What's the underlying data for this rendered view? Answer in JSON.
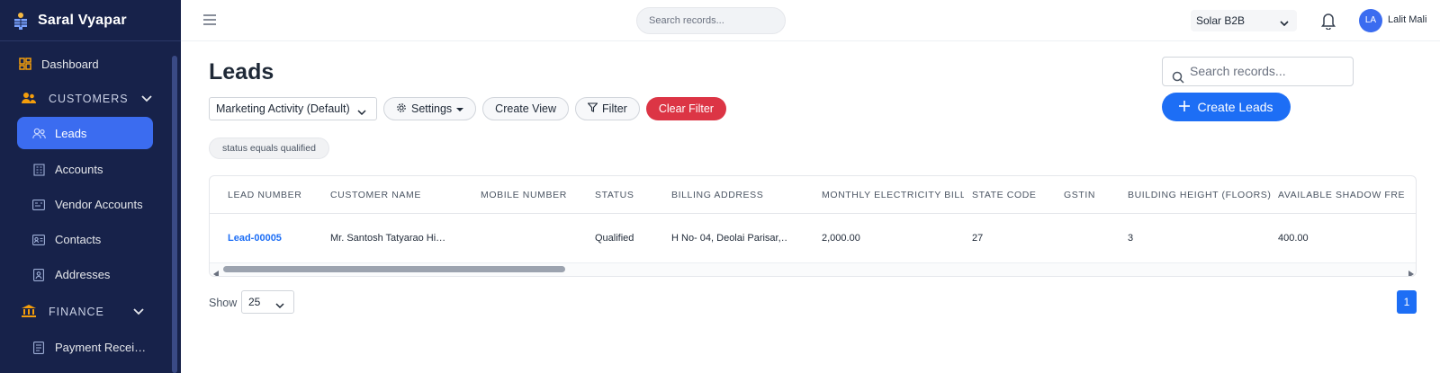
{
  "app": {
    "name": "Saral Vyapar"
  },
  "sidebar": {
    "dashboard": "Dashboard",
    "customers_section": "CUSTOMERS",
    "customers_items": [
      {
        "label": "Leads",
        "icon": "users-icon",
        "active": true
      },
      {
        "label": "Accounts",
        "icon": "building-icon"
      },
      {
        "label": "Vendor Accounts",
        "icon": "vendor-card-icon"
      },
      {
        "label": "Contacts",
        "icon": "contact-card-icon"
      },
      {
        "label": "Addresses",
        "icon": "address-book-icon"
      }
    ],
    "finance_section": "FINANCE",
    "finance_items": [
      {
        "label": "Payment Recei…",
        "icon": "receipt-icon"
      }
    ]
  },
  "topbar": {
    "search_placeholder": "Search records...",
    "org": "Solar B2B",
    "avatar_initials": "LA",
    "user_name": "Lalit Mali"
  },
  "page": {
    "title": "Leads",
    "search_placeholder": "Search records...",
    "create_label": "Create Leads",
    "view": "Marketing Activity (Default)",
    "settings_label": "Settings",
    "create_view_label": "Create View",
    "filter_label": "Filter",
    "clear_filter_label": "Clear Filter",
    "filter_chip": "status equals qualified"
  },
  "table": {
    "columns": [
      "LEAD NUMBER",
      "CUSTOMER NAME",
      "MOBILE NUMBER",
      "STATUS",
      "BILLING ADDRESS",
      "MONTHLY ELECTRICITY BILL ...",
      "STATE CODE",
      "GSTIN",
      "BUILDING HEIGHT (FLOORS)",
      "AVAILABLE SHADOW FRE"
    ],
    "rows": [
      [
        "Lead-00005",
        "Mr. Santosh Tatyarao Hi…",
        "",
        "Qualified",
        "H No- 04, Deolai Parisar,…",
        "2,000.00",
        "27",
        "",
        "3",
        "400.00"
      ]
    ]
  },
  "pagination": {
    "show_label": "Show",
    "page_size": "25",
    "current_page": "1"
  },
  "colors": {
    "sidebar_bg": "#17224a",
    "accent": "#1d6ef5",
    "active_nav": "#3b6cf0",
    "danger": "#dc3545"
  }
}
